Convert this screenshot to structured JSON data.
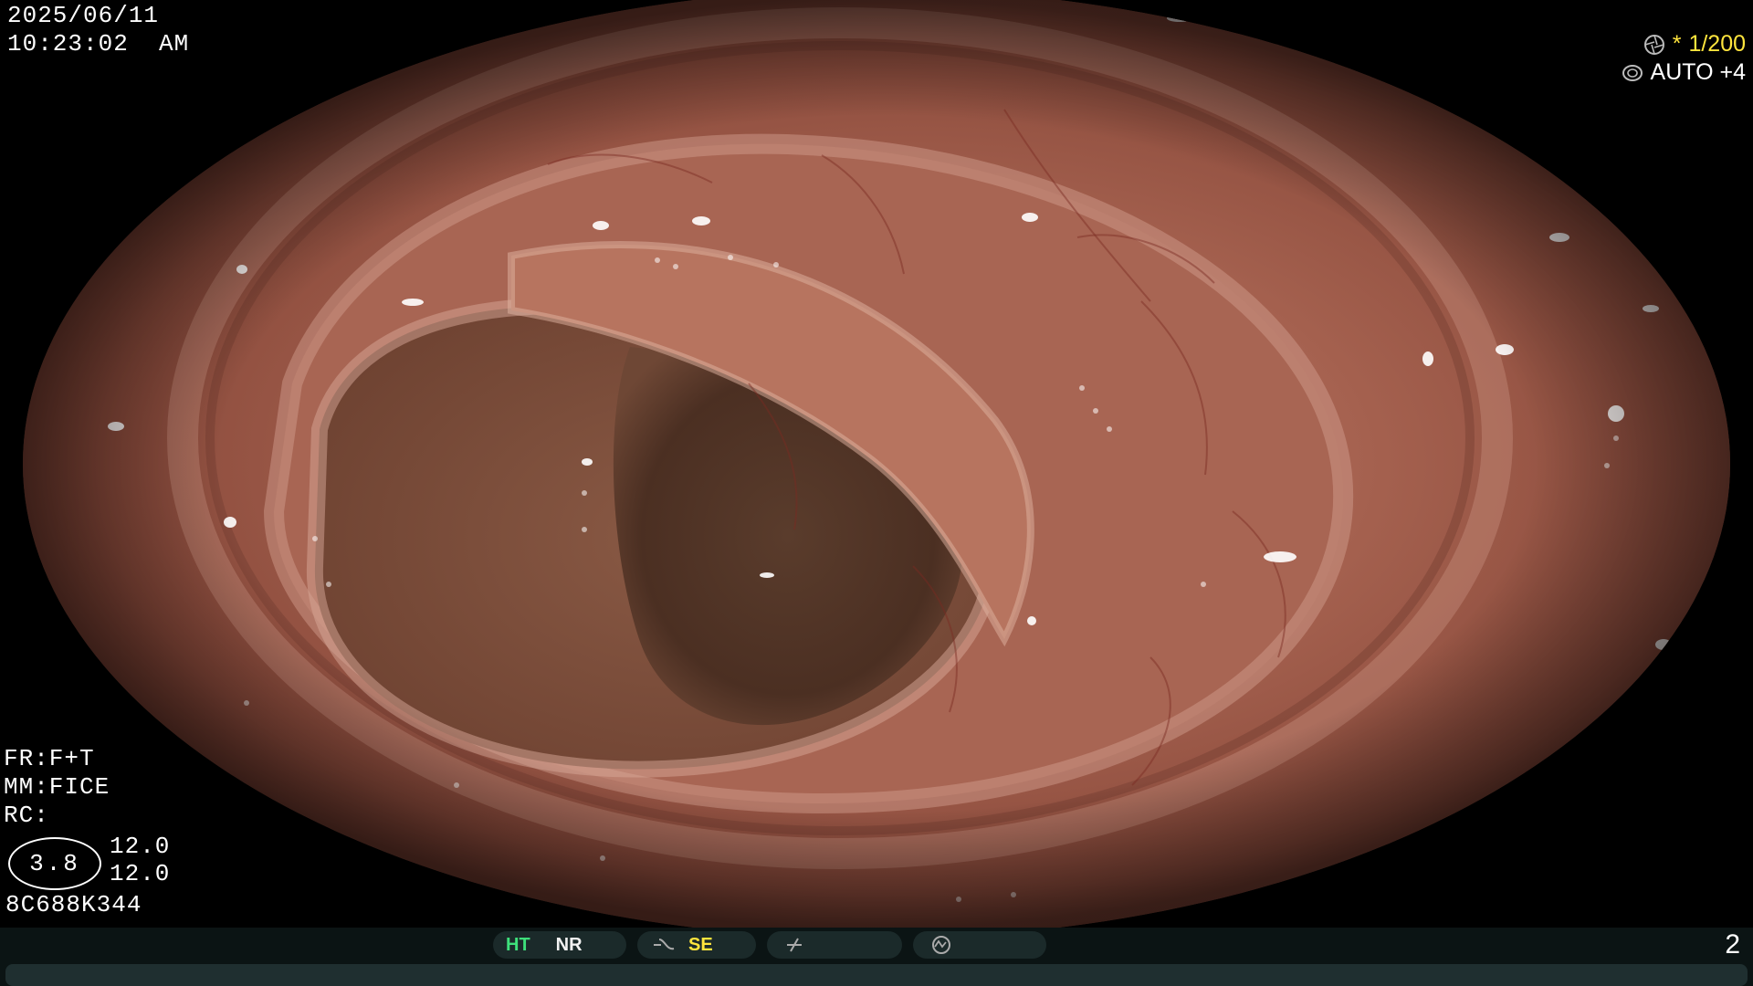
{
  "header": {
    "date": "2025/06/11",
    "time": "10:23:02  AM"
  },
  "exposure": {
    "shutter_icon": "shutter-icon",
    "asterisk": "*",
    "shutter": "1/200",
    "iris_icon": "iris-icon",
    "auto": "AUTO +4"
  },
  "left_info": {
    "fr": "FR:F+T",
    "mm": "MM:FICE",
    "rc": "RC:",
    "ellipse_value": "3.8",
    "value_1": "12.0",
    "value_2": "12.0",
    "scope_id": "8C688K344"
  },
  "status_bar": {
    "ht": "HT",
    "nr": "NR",
    "se": "SE",
    "mode_icon_1": "wave-icon",
    "mode_icon_2": "slash-icon",
    "mode_icon_3": "signal-circle-icon",
    "page_number": "2"
  },
  "colors": {
    "accent_yellow": "#ffe53d",
    "status_green": "#3ee07b",
    "status_bar_bg": "#0b1414",
    "mucosa": "#a0574a"
  }
}
